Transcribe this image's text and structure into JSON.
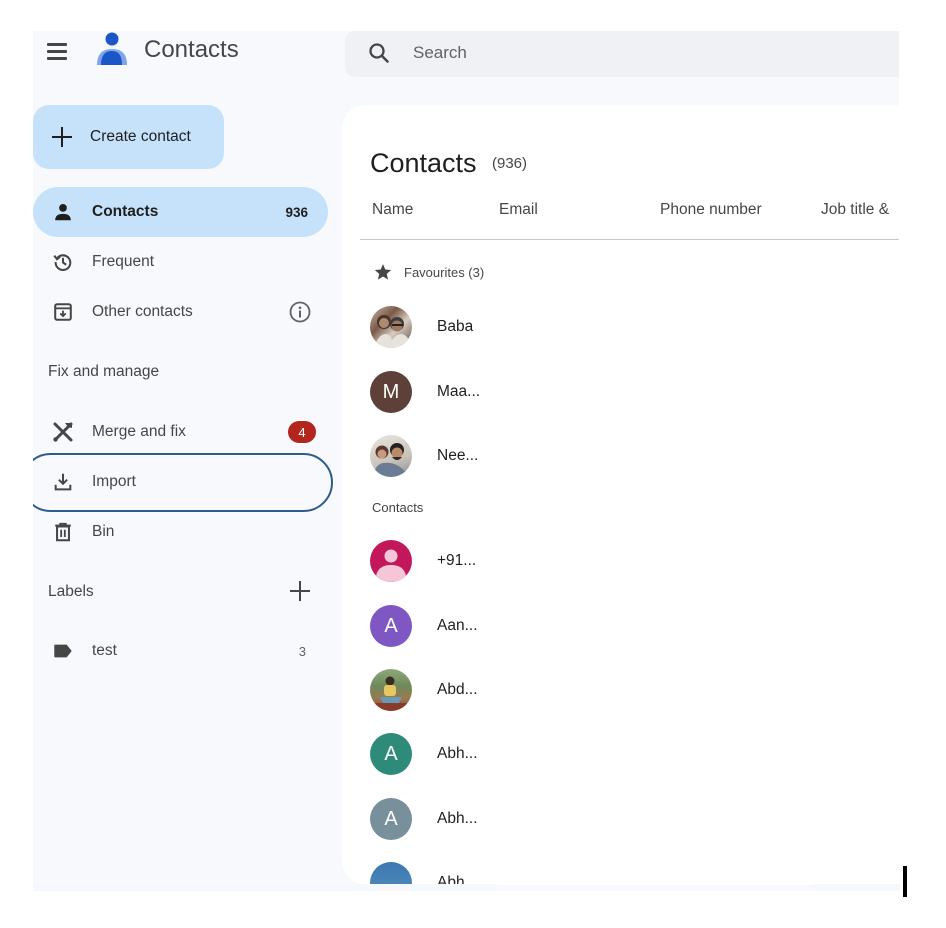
{
  "header": {
    "app_title": "Contacts",
    "menu_icon": "hamburger-menu-icon",
    "logo_icon": "contacts-logo-icon",
    "search": {
      "placeholder": "Search",
      "value": "",
      "icon": "search-icon"
    }
  },
  "sidebar": {
    "create_label": "Create contact",
    "items": [
      {
        "label": "Contacts",
        "count": "936",
        "icon": "person-icon",
        "active": true
      },
      {
        "label": "Frequent",
        "icon": "history-icon"
      },
      {
        "label": "Other contacts",
        "icon": "archive-download-icon",
        "trailing_icon": "info-icon"
      }
    ],
    "fix_section": "Fix and manage",
    "fix_items": [
      {
        "label": "Merge and fix",
        "icon": "tools-icon",
        "badge": "4"
      },
      {
        "label": "Import",
        "icon": "download-icon",
        "highlighted": true
      },
      {
        "label": "Bin",
        "icon": "trash-icon"
      }
    ],
    "labels_section": "Labels",
    "labels": [
      {
        "label": "test",
        "count": "3",
        "icon": "label-icon"
      }
    ]
  },
  "main": {
    "title": "Contacts",
    "count": "(936)",
    "columns": [
      "Name",
      "Email",
      "Phone number",
      "Job title &"
    ],
    "favourites_label": "Favourites (3)",
    "favourites": [
      {
        "name": "Baba",
        "avatar": "photo"
      },
      {
        "name": "Maa...",
        "avatar": "letter",
        "letter": "M",
        "color": "#5d4037"
      },
      {
        "name": "Nee...",
        "avatar": "photo"
      }
    ],
    "contacts_label": "Contacts",
    "contacts": [
      {
        "name": "+91...",
        "avatar": "default-person",
        "color": "#c2185b"
      },
      {
        "name": "Aan...",
        "avatar": "letter",
        "letter": "A",
        "color": "#7e57c2"
      },
      {
        "name": "Abd...",
        "avatar": "photo"
      },
      {
        "name": "Abh...",
        "avatar": "letter",
        "letter": "A",
        "color": "#2e8b7a"
      },
      {
        "name": "Abh...",
        "avatar": "letter",
        "letter": "A",
        "color": "#78909c"
      },
      {
        "name": "Abh",
        "avatar": "photo-partial",
        "color": "#3a78b0"
      }
    ]
  },
  "colors": {
    "accent_light": "#c6e2fa",
    "badge_red": "#b3261e",
    "highlight_ring": "#2d5b8c",
    "logo_blue": "#1a56c8"
  }
}
